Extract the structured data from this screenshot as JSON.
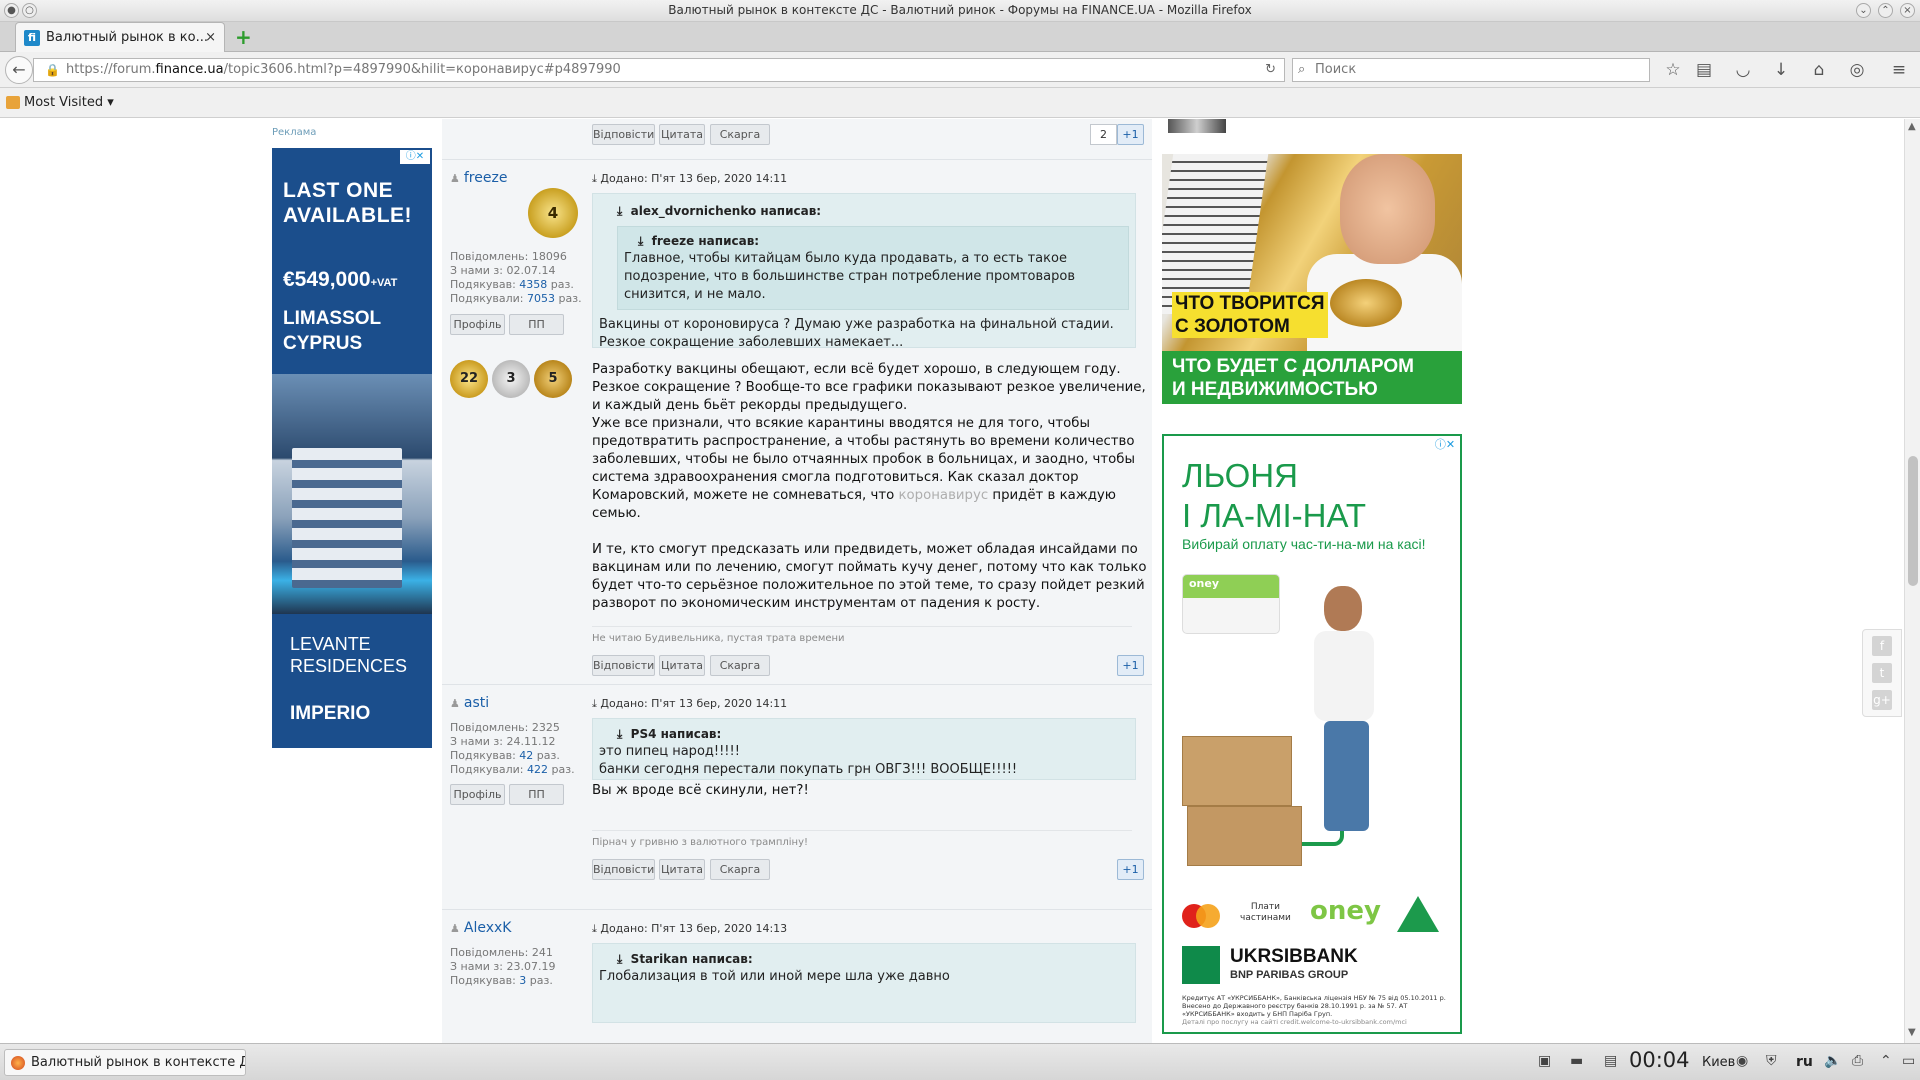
{
  "window": {
    "title": "Валютный рынок в контексте ДС - Валютний ринок - Форумы на FINANCE.UA - Mozilla Firefox"
  },
  "tab": {
    "title": "Валютный рынок в ко...",
    "close": "×",
    "new": "+"
  },
  "navbar": {
    "url_prefix": "https://forum.",
    "url_host": "finance.ua",
    "url_rest": "/topic3606.html?p=4897990&hilit=коронавирус#p4897990",
    "search_placeholder": "Поиск"
  },
  "bookmarks": {
    "most_visited": "Most Visited ▾"
  },
  "left_ad": {
    "label": "Реклама",
    "line1": "LAST ONE",
    "line2": "AVAILABLE!",
    "price": "€549,000",
    "vat": "+VAT",
    "city1": "LIMASSOL",
    "city2": "CYPRUS",
    "brand1": "LEVANTE",
    "brand2": "RESIDENCES",
    "brand3": "IMPERIO"
  },
  "buttons": {
    "reply": "Відповісти",
    "quote": "Цитата",
    "complaint": "Скарга",
    "profile": "Профіль",
    "pm": "ПП",
    "plus": "+1"
  },
  "posts": [
    {
      "top_count": "2"
    },
    {
      "author": "freeze",
      "rank": "4",
      "stats": {
        "posts_label": "Повідомлень:",
        "posts": "18096",
        "since_label": "З нами з:",
        "since": "02.07.14",
        "thanked_label": "Подякував:",
        "thanked": "4358",
        "times": "раз.",
        "thanked_by_label": "Подякували:",
        "thanked_by": "7053"
      },
      "medals": [
        "22",
        "3",
        "5"
      ],
      "date": "Додано: П'ят 13 бер, 2020 14:11",
      "quote_author": "alex_dvornichenko написав:",
      "inner_quote_author": "freeze написав:",
      "inner_quote_text": "Главное, чтобы китайцам было куда продавать, а то есть такое подозрение, что в большинстве стран потребление промтоваров снизится, и не мало.",
      "quote_text": "Вакцины от короновируса ? Думаю уже разработка на финальной стадии.\nРезкое сокращение заболевших намекает...",
      "body_a": "Разработку вакцины обещают, если всё будет хорошо, в следующем году.\nРезкое сокращение ? Вообще-то все графики показывают резкое увеличение, и каждый день бьёт рекорды предыдущего.\nУже все признали, что всякие карантины вводятся не для того, чтобы предотвратить распространение, а чтобы растянуть во времени количество заболевших, чтобы не было отчаянных пробок в больницах, и заодно, чтобы система здравоохранения смогла подготовиться. Как сказал доктор Комаровский, можете не сомневаться, что ",
      "body_hl": "коронавирус",
      "body_b": " придёт в каждую семью.\n\nИ те, кто смогут предсказать или предвидеть, может обладая инсайдами по вакцинам или по лечению, смогут поймать кучу денег, потому что как только будет что-то серьёзное положительное по этой теме, то сразу пойдет резкий разворот по экономическим инструментам от падения к росту.",
      "signature": "Не читаю Будивельника, пустая трата времени"
    },
    {
      "author": "asti",
      "stats": {
        "posts_label": "Повідомлень:",
        "posts": "2325",
        "since_label": "З нами з:",
        "since": "24.11.12",
        "thanked_label": "Подякував:",
        "thanked": "42",
        "times": "раз.",
        "thanked_by_label": "Подякували:",
        "thanked_by": "422"
      },
      "date": "Додано: П'ят 13 бер, 2020 14:11",
      "quote_author": "PS4 написав:",
      "quote_text": "это пипец народ!!!!!\nбанки сегодня перестали покупать грн ОВГЗ!!! ВООБЩЕ!!!!!",
      "body": "Вы ж вроде всё скинули, нет?!",
      "signature": "Пірнач у гривню з валютного трампліну!"
    },
    {
      "author": "AlexxK",
      "stats": {
        "posts_label": "Повідомлень:",
        "posts": "241",
        "since_label": "З нами з:",
        "since": "23.07.19",
        "thanked_label": "Подякував:",
        "thanked": "3",
        "times": "раз."
      },
      "date": "Додано: П'ят 13 бер, 2020 14:13",
      "quote_author": "Starikan написав:",
      "quote_text": "Глобализация в той или иной мере шла уже давно"
    }
  ],
  "gold_ad": {
    "line1": "ЧТО ТВОРИТСЯ",
    "line2": "С ЗОЛОТОМ",
    "line3": "ЧТО БУДЕТ С ДОЛЛАРОМ",
    "line4": "И НЕДВИЖИМОСТЬЮ"
  },
  "bank_ad": {
    "h1": "ЛЬОНЯ",
    "h2": "І ЛА-МІ-НАТ",
    "sub": "Вибирай оплату час-ти-на-ми на касі!",
    "card_brand": "oney",
    "plati1": "Плати",
    "plati2": "частинами",
    "oney": "oney",
    "bank_name": "UKRSIBBANK",
    "bank_sub": "BNP PARIBAS GROUP",
    "fine": "Кредитує АТ «УКРСИББАНК», Банківська ліцензія НБУ № 75 від 05.10.2011 р. Внесено до Державного реєстру банків 28.10.1991 р. за № 57. АТ «УКРСИББАНК» входить у БНП Паріба Груп.",
    "fine2": "Деталі про послугу на сайті credit.welcome-to-ukrsibbank.com/mci"
  },
  "taskbar": {
    "item": "Валютный рынок в контексте ДС - В",
    "time": "00:04",
    "city": "Киев",
    "lang": "ru"
  },
  "colors": {
    "accent": "#1b5fa8",
    "quote_bg": "#e1eef0",
    "bank_green": "#1a9a4b",
    "gold_green": "#29a13b"
  }
}
